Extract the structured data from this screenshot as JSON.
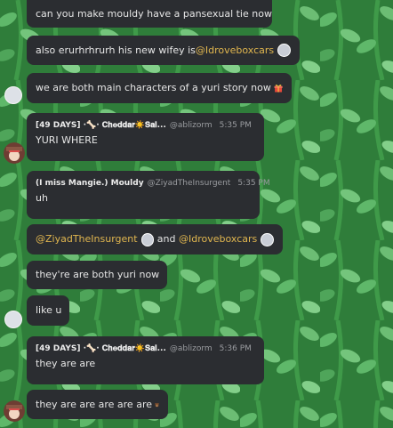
{
  "messages": {
    "m1": {
      "text": "can you make mouldy have a pansexual tie now"
    },
    "m2": {
      "text": "also erurhrhrurh his new wifey is ",
      "mention": "@Idroveboxcars"
    },
    "m3": {
      "text": "we are both main characters of a yuri story now"
    },
    "m4": {
      "author": "[49 DAYS] ·🦴· 𝐂𝐡𝐞𝐝𝐝𝐚𝐫☀️𝐒𝐚𝐥...",
      "handle": "@ablizorm",
      "time": "5:35 PM",
      "text": "YURI WHERE"
    },
    "m5": {
      "author": "(I miss Mangie.) Mouldy",
      "handle": "@ZiyadTheInsurgent",
      "time": "5:35 PM",
      "text": "uh"
    },
    "m6": {
      "mention1": "@ZiyadTheInsurgent",
      "and": " and ",
      "mention2": "@Idroveboxcars"
    },
    "m7": {
      "text": "they're are both yuri now"
    },
    "m8": {
      "text": "like u"
    },
    "m9": {
      "author": "[49 DAYS] ·🦴· 𝐂𝐡𝐞𝐝𝐝𝐚𝐫☀️𝐒𝐚𝐥...",
      "handle": "@ablizorm",
      "time": "5:36 PM",
      "text": "they are are"
    },
    "m10": {
      "text": "they are are are are are"
    }
  },
  "icons": {
    "gift": "gift-emoji-icon",
    "bear": "bear-emoji-icon",
    "avatar_ghost": "ghost-avatar",
    "avatar_hat": "hat-character-avatar"
  },
  "colors": {
    "bubble": "#2b2d31",
    "mention": "#e0b64f",
    "background": "#2f7d3a"
  }
}
